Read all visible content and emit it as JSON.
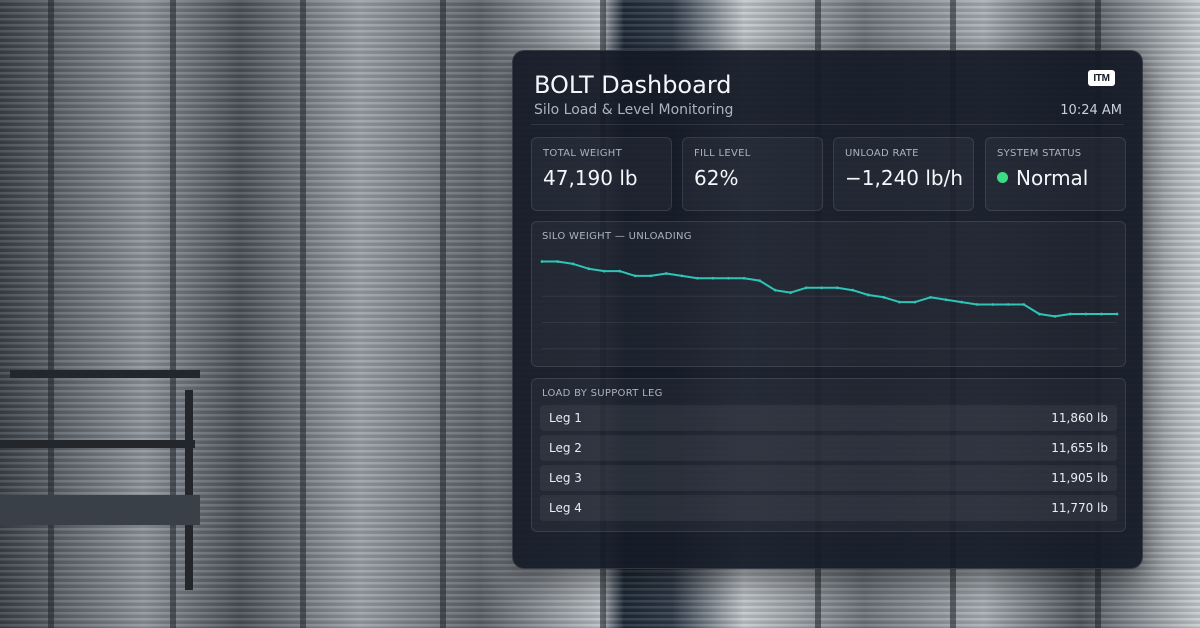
{
  "header": {
    "title": "BOLT Dashboard",
    "subtitle": "Silo Load & Level Monitoring",
    "logo_text": "ITM",
    "time": "10:24 AM"
  },
  "metrics": [
    {
      "label": "TOTAL WEIGHT",
      "value": "47,190 lb"
    },
    {
      "label": "FILL LEVEL",
      "value": "62%"
    },
    {
      "label": "UNLOAD RATE",
      "value": "−1,240 lb/h"
    },
    {
      "label": "SYSTEM STATUS",
      "value": "Normal",
      "status_color": "#3ddc84"
    }
  ],
  "chart": {
    "label": "SILO WEIGHT — UNLOADING",
    "line_color": "#2ec4b6"
  },
  "chart_data": {
    "type": "line",
    "title": "SILO WEIGHT — UNLOADING",
    "grid": true,
    "series": [
      {
        "values": [
          100,
          100,
          99,
          97,
          96,
          96,
          94,
          94,
          95,
          94,
          93,
          93,
          93,
          93,
          92,
          88,
          87,
          89,
          89,
          89,
          88,
          86,
          85,
          83,
          83,
          85,
          84,
          83,
          82,
          82,
          82,
          82,
          78,
          77,
          78,
          78,
          78,
          78
        ]
      }
    ],
    "ylim": [
      60,
      104
    ]
  },
  "legs": {
    "label": "LOAD BY SUPPORT LEG",
    "rows": [
      {
        "name": "Leg 1",
        "value": "11,860 lb"
      },
      {
        "name": "Leg 2",
        "value": "11,655 lb"
      },
      {
        "name": "Leg 3",
        "value": "11,905 lb"
      },
      {
        "name": "Leg 4",
        "value": "11,770 lb"
      }
    ]
  }
}
